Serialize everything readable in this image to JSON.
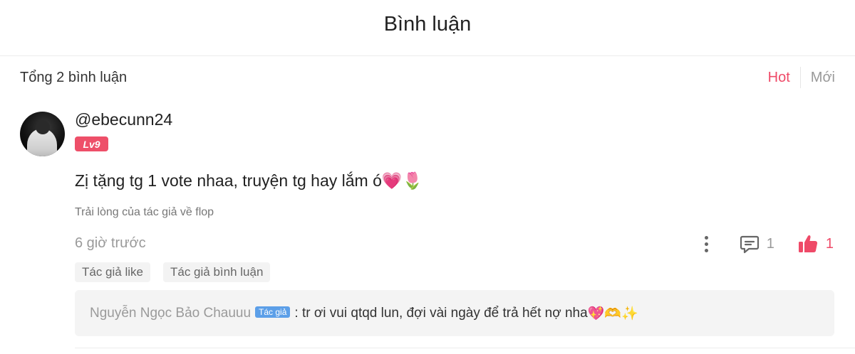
{
  "header": {
    "title": "Bình luận"
  },
  "toolbar": {
    "total_label": "Tổng 2 bình luận",
    "sort_options": [
      "Hot",
      "Mới"
    ],
    "active_sort": "Hot",
    "accent_color": "#ef4a68"
  },
  "comment": {
    "username": "@ebecunn24",
    "level": "Lv9",
    "text": "Zị tặng tg 1 vote nhaa, truyện tg hay lắm ó",
    "emojis": "💗🌷",
    "chapter": "Trải lòng của tác giả về flop",
    "time": "6 giờ trước",
    "reply_count": "1",
    "like_count": "1",
    "tags": [
      "Tác giả like",
      "Tác giả bình luận"
    ]
  },
  "reply": {
    "author": "Nguyễn Ngọc Bảo Chauuu",
    "badge": "Tác giả",
    "text": ": tr ơi vui qtqd lun, đợi vài ngày để trả hết nợ nha",
    "emojis": "💖🫶✨"
  },
  "icons": {
    "more": "more-vertical-icon",
    "reply": "comment-bubble-icon",
    "like": "thumbs-up-icon"
  }
}
